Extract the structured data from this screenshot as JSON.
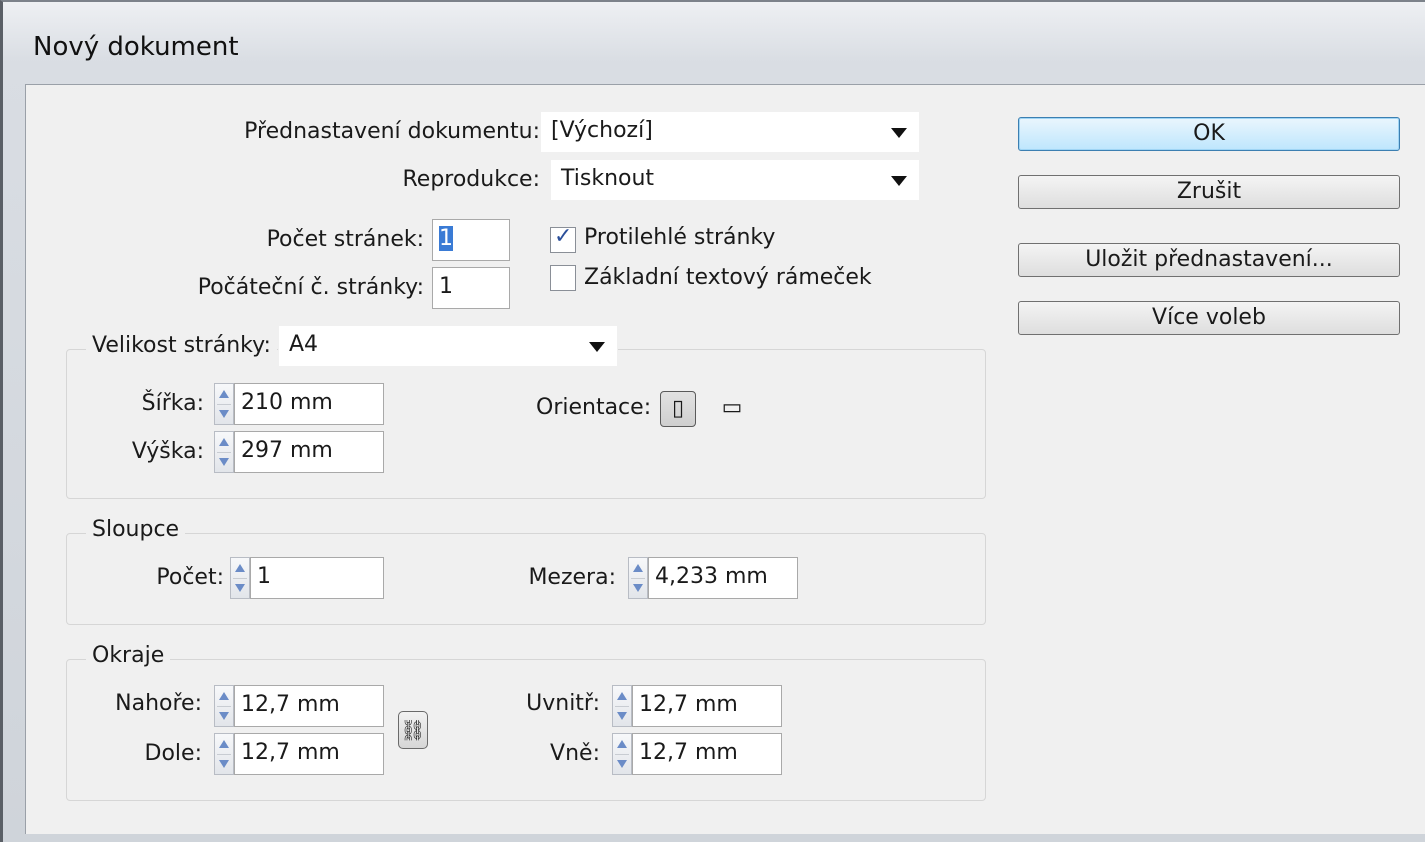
{
  "window": {
    "title": "Nový dokument"
  },
  "preset": {
    "label": "Přednastavení dokumentu:",
    "value": "[Výchozí]"
  },
  "intent": {
    "label": "Reprodukce:",
    "value": "Tisknout"
  },
  "pages": {
    "count_label": "Počet stránek:",
    "count_value": "1",
    "start_label": "Počáteční č. stránky:",
    "start_value": "1",
    "facing_label": "Protilehlé stránky",
    "facing_checked": true,
    "master_frame_label": "Základní textový rámeček",
    "master_frame_checked": false
  },
  "page_size": {
    "label": "Velikost stránky:",
    "value": "A4",
    "width_label": "Šířka:",
    "width_value": "210 mm",
    "height_label": "Výška:",
    "height_value": "297 mm",
    "orientation_label": "Orientace:",
    "orientation_selected": "portrait"
  },
  "columns": {
    "legend": "Sloupce",
    "count_label": "Počet:",
    "count_value": "1",
    "gutter_label": "Mezera:",
    "gutter_value": "4,233 mm"
  },
  "margins": {
    "legend": "Okraje",
    "top_label": "Nahoře:",
    "top_value": "12,7 mm",
    "bottom_label": "Dole:",
    "bottom_value": "12,7 mm",
    "inside_label": "Uvnitř:",
    "inside_value": "12,7 mm",
    "outside_label": "Vně:",
    "outside_value": "12,7 mm"
  },
  "buttons": {
    "ok": "OK",
    "cancel": "Zrušit",
    "save_preset": "Uložit přednastavení...",
    "more_options": "Více voleb"
  }
}
